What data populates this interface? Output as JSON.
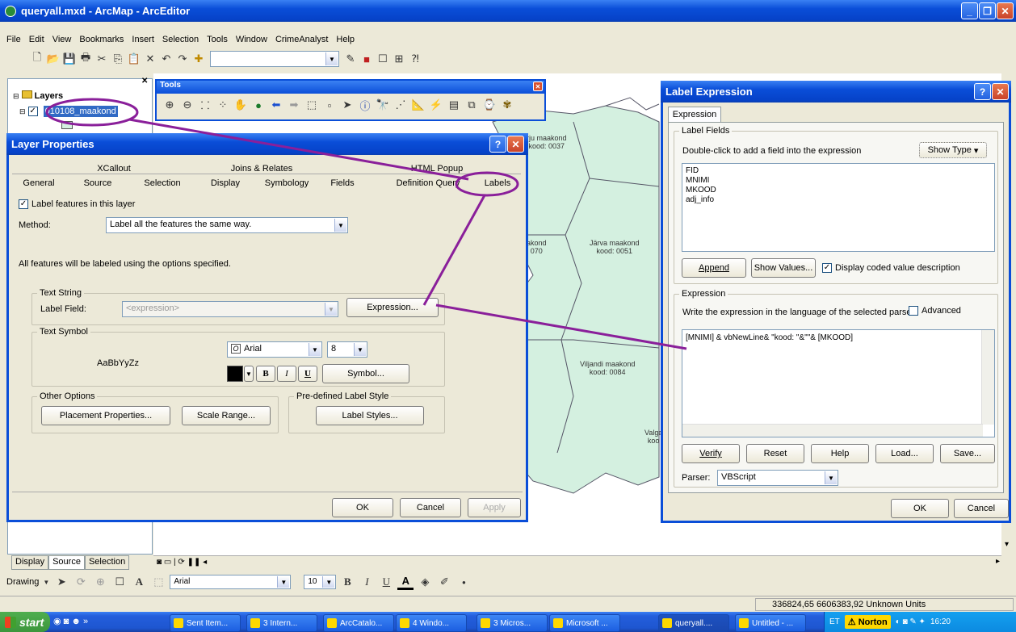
{
  "window": {
    "title": "queryall.mxd - ArcMap - ArcEditor"
  },
  "menubar": [
    "File",
    "Edit",
    "View",
    "Bookmarks",
    "Insert",
    "Selection",
    "Tools",
    "Window",
    "CrimeAnalyst",
    "Help"
  ],
  "toc": {
    "root_label": "Layers",
    "layer_label": "010108_maakond",
    "tabs": [
      "Display",
      "Source",
      "Selection"
    ]
  },
  "tools_window": {
    "title": "Tools"
  },
  "map_labels": [
    {
      "name": "rju maakond",
      "code": "kood: 0037"
    },
    {
      "name": "akond",
      "code": "070"
    },
    {
      "name": "Järva maakond",
      "code": "kood: 0051"
    },
    {
      "name": "Viljandi maakond",
      "code": "kood: 0084"
    },
    {
      "name": "Valga",
      "code": "koo"
    }
  ],
  "layer_properties": {
    "title": "Layer Properties",
    "tabs_row1": [
      "XCallout",
      "Joins & Relates",
      "HTML Popup"
    ],
    "tabs_row2": [
      "General",
      "Source",
      "Selection",
      "Display",
      "Symbology",
      "Fields",
      "Definition Query",
      "Labels"
    ],
    "label_features": "Label features in this layer",
    "method_label": "Method:",
    "method_value": "Label all the features the same way.",
    "info_text": "All features will be labeled using the options specified.",
    "text_string_group": "Text String",
    "label_field_label": "Label Field:",
    "label_field_value": "<expression>",
    "expression_button": "Expression...",
    "text_symbol_group": "Text Symbol",
    "sample_text": "AaBbYyZz",
    "font_value": "Arial",
    "size_value": "8",
    "bold": "B",
    "italic": "I",
    "underline": "U",
    "symbol_button": "Symbol...",
    "other_options_group": "Other Options",
    "placement_button": "Placement Properties...",
    "scale_button": "Scale Range...",
    "predefined_group": "Pre-defined Label Style",
    "label_styles_button": "Label Styles...",
    "ok": "OK",
    "cancel": "Cancel",
    "apply": "Apply"
  },
  "label_expression": {
    "title": "Label Expression",
    "tab": "Expression",
    "fields_group": "Label Fields",
    "fields_hint": "Double-click to add a field into the expression",
    "show_type": "Show Type",
    "fields": [
      "FID",
      "MNIMI",
      "MKOOD",
      "adj_info"
    ],
    "append": "Append",
    "show_values": "Show Values...",
    "display_coded": "Display coded value description",
    "expression_group": "Expression",
    "expression_hint": "Write the expression in the language of the selected parser.",
    "advanced": "Advanced",
    "expression_text": "[MNIMI] & vbNewLine& \"kood: \"&\"\"& [MKOOD]",
    "verify": "Verify",
    "reset": "Reset",
    "help": "Help",
    "load": "Load...",
    "save": "Save...",
    "parser_label": "Parser:",
    "parser_value": "VBScript",
    "ok": "OK",
    "cancel": "Cancel"
  },
  "drawing_toolbar": {
    "drawing": "Drawing",
    "font": "Arial",
    "size": "10"
  },
  "statusbar": {
    "coords": "336824,65  6606383,92 Unknown Units"
  },
  "taskbar": {
    "start": "start",
    "items": [
      "Sent Item...",
      "3 Intern...",
      "ArcCatalo...",
      "4 Windo...",
      "3 Micros...",
      "Microsoft ...",
      "queryall....",
      "Untitled - ..."
    ],
    "lang": "ET",
    "norton": "Norton",
    "clock": "16:20"
  },
  "colors": {
    "map_fill": "#d4f0e0",
    "annotation": "#8a1f9a",
    "title_blue": "#0a4ed8"
  }
}
